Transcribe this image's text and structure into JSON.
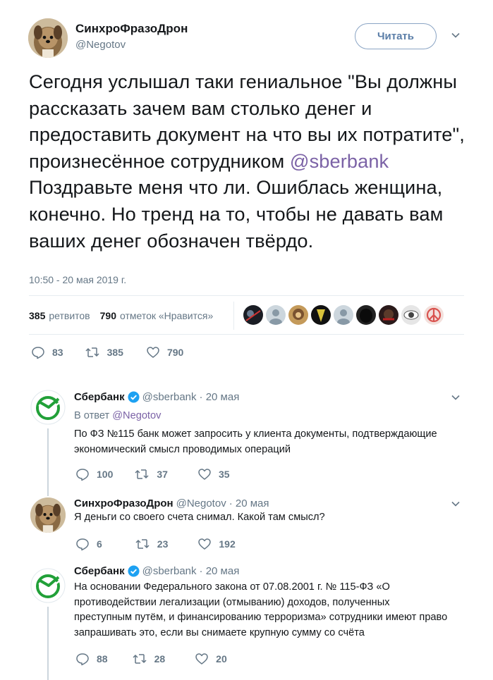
{
  "main": {
    "name": "СинхроФразоДрон",
    "handle": "@Negotov",
    "follow_label": "Читать",
    "text_before": "Сегодня услышал таки гениальное \"Вы должны рассказать зачем вам столько денег и предоставить документ на что вы их потратите\", произнесённое сотрудником ",
    "mention": "@sberbank",
    "text_after": " Поздравьте меня что ли. Ошиблась женщина, конечно. Но тренд на то, чтобы не давать вам ваших денег обозначен твёрдо.",
    "time": "10:50 - 20 мая 2019 г.",
    "retweets_count": "385",
    "retweets_label": "ретвитов",
    "likes_count": "790",
    "likes_label": "отметок «Нравится»",
    "actions": {
      "replies": "83",
      "retweets": "385",
      "likes": "790"
    }
  },
  "replies": [
    {
      "name": "Сбербанк",
      "handle": "@sberbank",
      "date": "· 20 мая",
      "reply_to_label": "В ответ ",
      "reply_to_handle": "@Negotov",
      "text": "По ФЗ №115 банк может запросить у клиента документы, подтверждающие экономический смысл проводимых операций",
      "actions": {
        "replies": "100",
        "retweets": "37",
        "likes": "35"
      }
    },
    {
      "name": "СинхроФразоДрон",
      "handle": "@Negotov",
      "date": "· 20 мая",
      "text": "Я деньги со своего счета снимал. Какой там смысл?",
      "actions": {
        "replies": "6",
        "retweets": "23",
        "likes": "192"
      }
    },
    {
      "name": "Сбербанк",
      "handle": "@sberbank",
      "date": "· 20 мая",
      "text": "На основании Федерального закона от 07.08.2001 г. № 115-ФЗ «О противодействии легализации (отмыванию) доходов, полученных преступным путём, и финансированию терроризма» сотрудники имеют право запрашивать это, если вы снимаете крупную сумму со счёта",
      "actions": {
        "replies": "88",
        "retweets": "28",
        "likes": "20"
      }
    }
  ],
  "colors": {
    "accent": "#7b62a6",
    "sber_green": "#21a038",
    "verified_blue": "#1da1f2"
  }
}
